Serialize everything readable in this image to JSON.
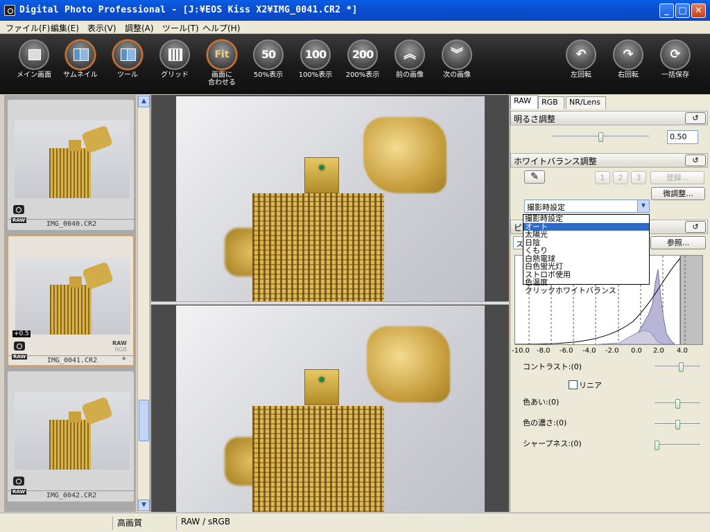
{
  "window": {
    "title": "Digital Photo Professional - [J:¥EOS Kiss X2¥IMG_0041.CR2 *]",
    "min_label": "_",
    "max_label": "□",
    "close_label": "✕"
  },
  "menu": [
    "ファイル(F)",
    "編集(E)",
    "表示(V)",
    "調整(A)",
    "ツール(T)",
    "ヘルプ(H)"
  ],
  "toolbar": {
    "main": "メイン画面",
    "thumbnail": "サムネイル",
    "tool": "ツール",
    "grid": "グリッド",
    "fit_line1": "画面に",
    "fit_line2": "合わせる",
    "fit_glyph": "Fit",
    "z50": "50%表示",
    "z50_glyph": "50",
    "z100": "100%表示",
    "z100_glyph": "100",
    "z200": "200%表示",
    "z200_glyph": "200",
    "prev": "前の画像",
    "next": "次の画像",
    "rotl": "左回転",
    "rotr": "右回転",
    "saveall": "一括保存"
  },
  "thumbnails": [
    {
      "name": "IMG_0040.CR2",
      "raw": "RAW"
    },
    {
      "name": "IMG_0041.CR2",
      "raw": "RAW",
      "ev": "+0.5",
      "rawrgb1": "RAW",
      "rawrgb2": "RGB",
      "star": "*"
    },
    {
      "name": "IMG_0042.CR2",
      "raw": "RAW"
    }
  ],
  "panel": {
    "tabs": [
      "RAW",
      "RGB",
      "NR/Lens"
    ],
    "brightness": {
      "title": "明るさ調整",
      "value": "0.50",
      "slider": 0.5
    },
    "wb": {
      "title": "ホワイトバランス調整",
      "presets": [
        "1",
        "2",
        "3"
      ],
      "register": "登録...",
      "fine": "微調整...",
      "selected": "撮影時設定",
      "options": [
        "撮影時設定",
        "オート",
        "太陽光",
        "日陰",
        "くもり",
        "白熱電球",
        "白色蛍光灯",
        "ストロボ使用",
        "色温度",
        "クリックホワイトバランス"
      ],
      "highlighted": "オート"
    },
    "picture_style": {
      "title": "ピ",
      "style_prefix": "ス",
      "browse": "参照..."
    },
    "hist_axis": [
      "-10.0",
      "-8.0",
      "-6.0",
      "-4.0",
      "-2.0",
      "0.0",
      "2.0",
      "4.0"
    ],
    "contrast": {
      "label": "コントラスト:(0)",
      "level": 0.6
    },
    "linear": "リニア",
    "hue": {
      "label": "色あい:(0)",
      "level": 0.5
    },
    "saturation": {
      "label": "色の濃さ:(0)",
      "level": 0.5
    },
    "sharpness": {
      "label": "シャープネス:(0)",
      "level": 0.0
    },
    "reset": "↺"
  },
  "status": {
    "quality": "高画質",
    "mode": "RAW / sRGB"
  },
  "scroll": {
    "up": "▲",
    "down": "▼"
  }
}
